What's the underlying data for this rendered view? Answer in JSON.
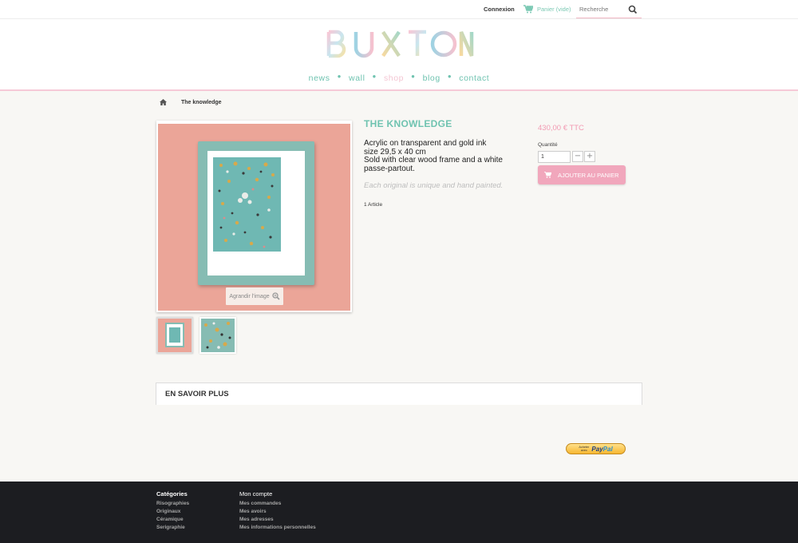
{
  "topbar": {
    "login_label": "Connexion",
    "cart_label": "Panier (vide)",
    "search_placeholder": "Recherche"
  },
  "brand": {
    "logo_text": "BUXTON"
  },
  "nav": {
    "items": [
      {
        "label": "news"
      },
      {
        "label": "wall"
      },
      {
        "label": "shop"
      },
      {
        "label": "blog"
      },
      {
        "label": "contact"
      }
    ],
    "active": "shop"
  },
  "breadcrumb": {
    "current": "The knowledge"
  },
  "gallery": {
    "zoom_label": "Agrandir l'image"
  },
  "product": {
    "title": "THE KNOWLEDGE",
    "description_lines": [
      "Acrylic on transparent and gold ink",
      "size 29,5 x 40 cm",
      "Sold with clear wood frame and a white passe-partout."
    ],
    "note": "Each original is unique and hand painted.",
    "stock": "1 Article",
    "price": "430,00 € TTC",
    "quantity_label": "Quantité",
    "quantity_value": "1",
    "add_to_cart_label": "AJOUTER AU PANIER"
  },
  "more": {
    "title": "EN SAVOIR PLUS"
  },
  "paypal": {
    "small_text_1": "Acheter",
    "small_text_2": "avec",
    "logo_1": "Pay",
    "logo_2": "Pal"
  },
  "footer": {
    "categories": {
      "title": "Catégories",
      "links": [
        "Risographies",
        "Originaux",
        "Céramique",
        "Serigraphie"
      ]
    },
    "account": {
      "title": "Mon compte",
      "links": [
        "Mes commandes",
        "Mes avoirs",
        "Mes adresses",
        "Mes informations personnelles"
      ]
    }
  },
  "colors": {
    "accent_green": "#6fc3b0",
    "accent_pink": "#f1a7bc",
    "price_pink": "#f29ab2",
    "footer_bg": "#1c1d21"
  }
}
